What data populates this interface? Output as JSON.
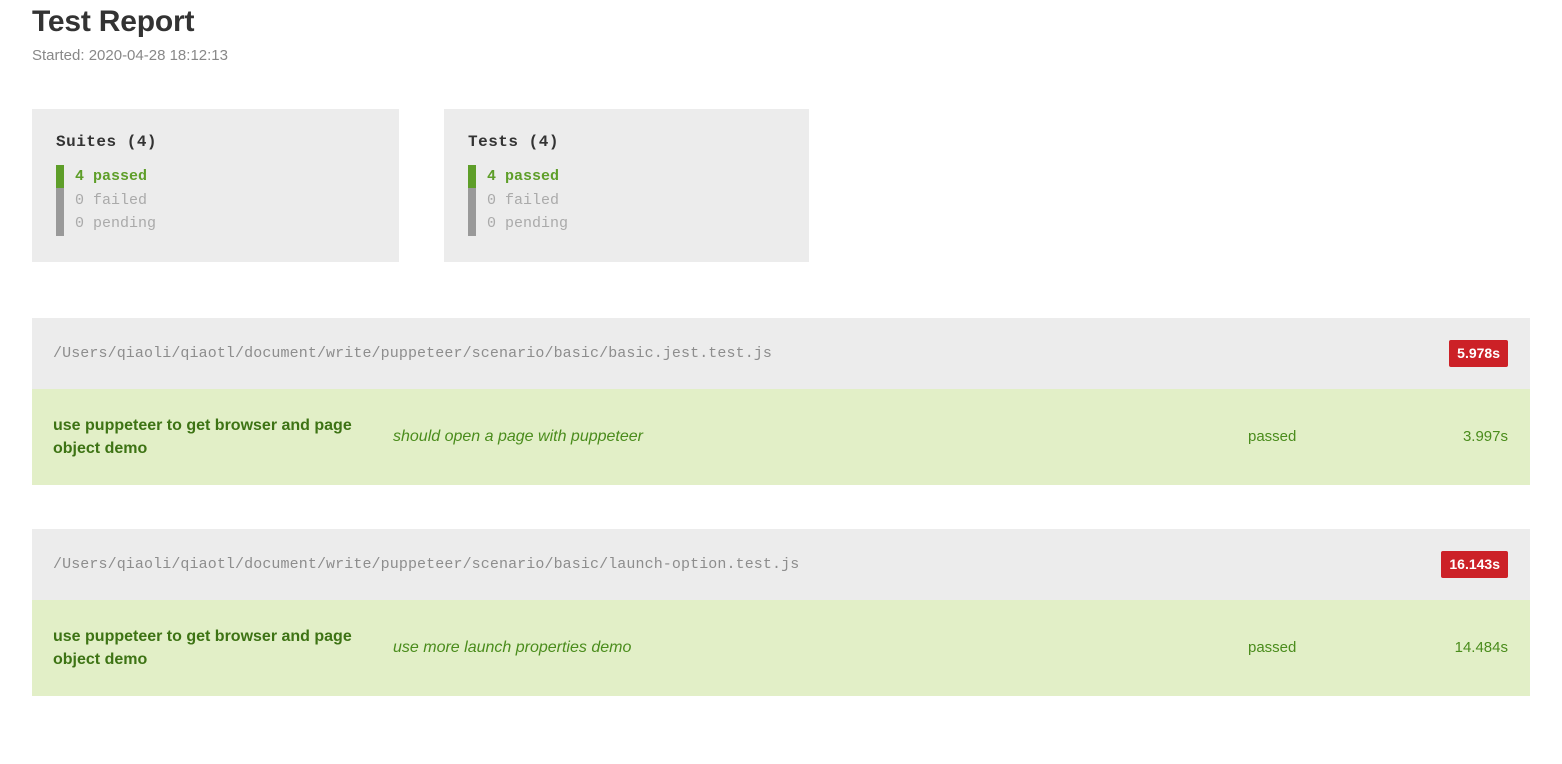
{
  "header": {
    "title": "Test Report",
    "started_label": "Started: 2020-04-28 18:12:13"
  },
  "summary": {
    "boxes": [
      {
        "heading": "Suites (4)",
        "passed": "4 passed",
        "failed": "0 failed",
        "pending": "0 pending",
        "passed_count": 4,
        "failed_count": 0,
        "pending_count": 0,
        "total": 4
      },
      {
        "heading": "Tests (4)",
        "passed": "4 passed",
        "failed": "0 failed",
        "pending": "0 pending",
        "passed_count": 4,
        "failed_count": 0,
        "pending_count": 0,
        "total": 4
      }
    ]
  },
  "colors": {
    "passed_green": "#5e9e29",
    "muted_gray": "#aaaaaa",
    "badge_red": "#cc2127",
    "block_gray": "#ececec",
    "row_green": "#e2efc7"
  },
  "suites": [
    {
      "path": "/Users/qiaoli/qiaotl/document/write/puppeteer/scenario/basic/basic.jest.test.js",
      "duration": "5.978s",
      "tests": [
        {
          "suite_name": "use puppeteer to get browser and page object demo",
          "title": "should open a page with puppeteer",
          "status": "passed",
          "duration": "3.997s"
        }
      ]
    },
    {
      "path": "/Users/qiaoli/qiaotl/document/write/puppeteer/scenario/basic/launch-option.test.js",
      "duration": "16.143s",
      "tests": [
        {
          "suite_name": "use puppeteer to get browser and page object demo",
          "title": "use more launch properties demo",
          "status": "passed",
          "duration": "14.484s"
        }
      ]
    }
  ]
}
